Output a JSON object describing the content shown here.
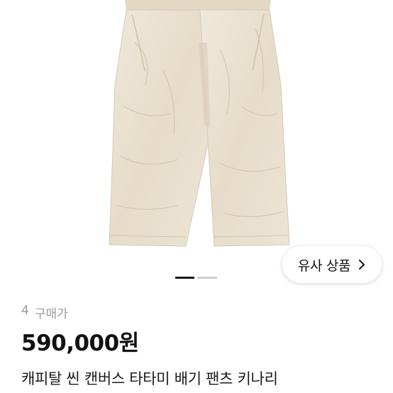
{
  "product_image": {
    "subject": "pants-photo",
    "background": "#ffffff",
    "fabric_color": "#ece4d5"
  },
  "similar_button": {
    "label": "유사 상품",
    "icon": "chevron-right-icon"
  },
  "carousel": {
    "total": 2,
    "active": 1
  },
  "meta": {
    "buyer_count": "4",
    "buyer_label": "구매가"
  },
  "price": "590,000원",
  "title": "캐피탈 씬 캔버스 타타미 배기 팬츠 키나리"
}
